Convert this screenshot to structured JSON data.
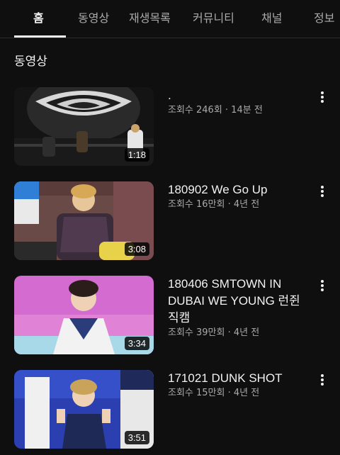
{
  "tabs": [
    {
      "label": "홈",
      "active": true
    },
    {
      "label": "동영상",
      "active": false
    },
    {
      "label": "재생목록",
      "active": false
    },
    {
      "label": "커뮤니티",
      "active": false
    },
    {
      "label": "채널",
      "active": false
    },
    {
      "label": "정보",
      "active": false
    }
  ],
  "section_title": "동영상",
  "videos": [
    {
      "title": ".",
      "meta": "조회수 246회 · 14분 전",
      "duration": "1:18"
    },
    {
      "title": "180902 We Go Up",
      "meta": "조회수 16만회 · 4년 전",
      "duration": "3:08"
    },
    {
      "title": "180406 SMTOWN IN DUBAI WE YOUNG 런쥔직캠",
      "meta": "조회수 39만회 · 4년 전",
      "duration": "3:34"
    },
    {
      "title": "171021 DUNK SHOT",
      "meta": "조회수 15만회 · 4년 전",
      "duration": "3:51"
    }
  ],
  "icons": {
    "more": "more-vert-icon"
  },
  "colors": {
    "background": "#0f0f0f",
    "text": "#f1f1f1",
    "secondary": "#aaaaaa"
  }
}
